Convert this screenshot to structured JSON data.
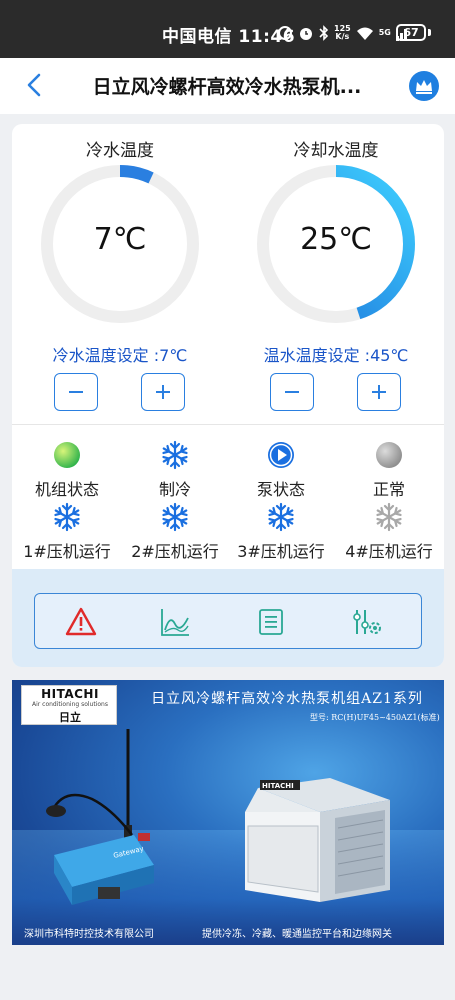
{
  "status_bar": {
    "carrier_time": "中国电信 11:46",
    "net_speed_value": "125",
    "net_speed_unit": "K/s",
    "signal_label": "5G",
    "battery": "67"
  },
  "header": {
    "title": "日立风冷螺杆高效冷水热泵机..."
  },
  "gauges": [
    {
      "title": "冷水温度",
      "value": "7℃",
      "setpoint": "冷水温度设定 :7℃",
      "fill_fraction": 0.07,
      "colors": [
        "#2a7fe0",
        "#2a7fe0"
      ]
    },
    {
      "title": "冷却水温度",
      "value": "25℃",
      "setpoint": "温水温度设定 :45℃",
      "fill_fraction": 0.45,
      "colors": [
        "#1a6fd8",
        "#3fd0ff"
      ]
    }
  ],
  "status_items": [
    {
      "icon": "green-status-dot-icon",
      "label": "机组状态"
    },
    {
      "icon": "snowflake-icon",
      "label": "制冷"
    },
    {
      "icon": "play-circle-icon",
      "label": "泵状态"
    },
    {
      "icon": "gray-status-dot-icon",
      "label": "正常"
    },
    {
      "icon": "snowflake-icon",
      "label": "1#压机运行"
    },
    {
      "icon": "snowflake-icon",
      "label": "2#压机运行"
    },
    {
      "icon": "snowflake-icon",
      "label": "3#压机运行"
    },
    {
      "icon": "snowflake-gray-icon",
      "label": "4#压机运行"
    }
  ],
  "toolbar": {
    "items": [
      "alarm-warning-icon",
      "trend-chart-icon",
      "list-document-icon",
      "settings-sliders-icon"
    ]
  },
  "banner": {
    "brand": "HITACHI",
    "brand_sub": "Air conditioning solutions",
    "brand_cn": "日立",
    "title": "日立风冷螺杆高效冷水热泵机组AZ1系列",
    "model": "型号: RC(H)UF45~450AZ1(标准)",
    "footer_left": "深圳市科特时控技术有限公司",
    "footer_right": "提供冷冻、冷藏、暖通监控平台和边缘网关",
    "gateway_label": "Gateway",
    "unit_logo": "HITACHI"
  },
  "colors": {
    "accent": "#2a7fe0",
    "setpoint_text": "#1a55c8",
    "status_bar": "#2b2b2b",
    "alarm_red": "#e02a2a",
    "toolbar_green": "#2aa894"
  }
}
